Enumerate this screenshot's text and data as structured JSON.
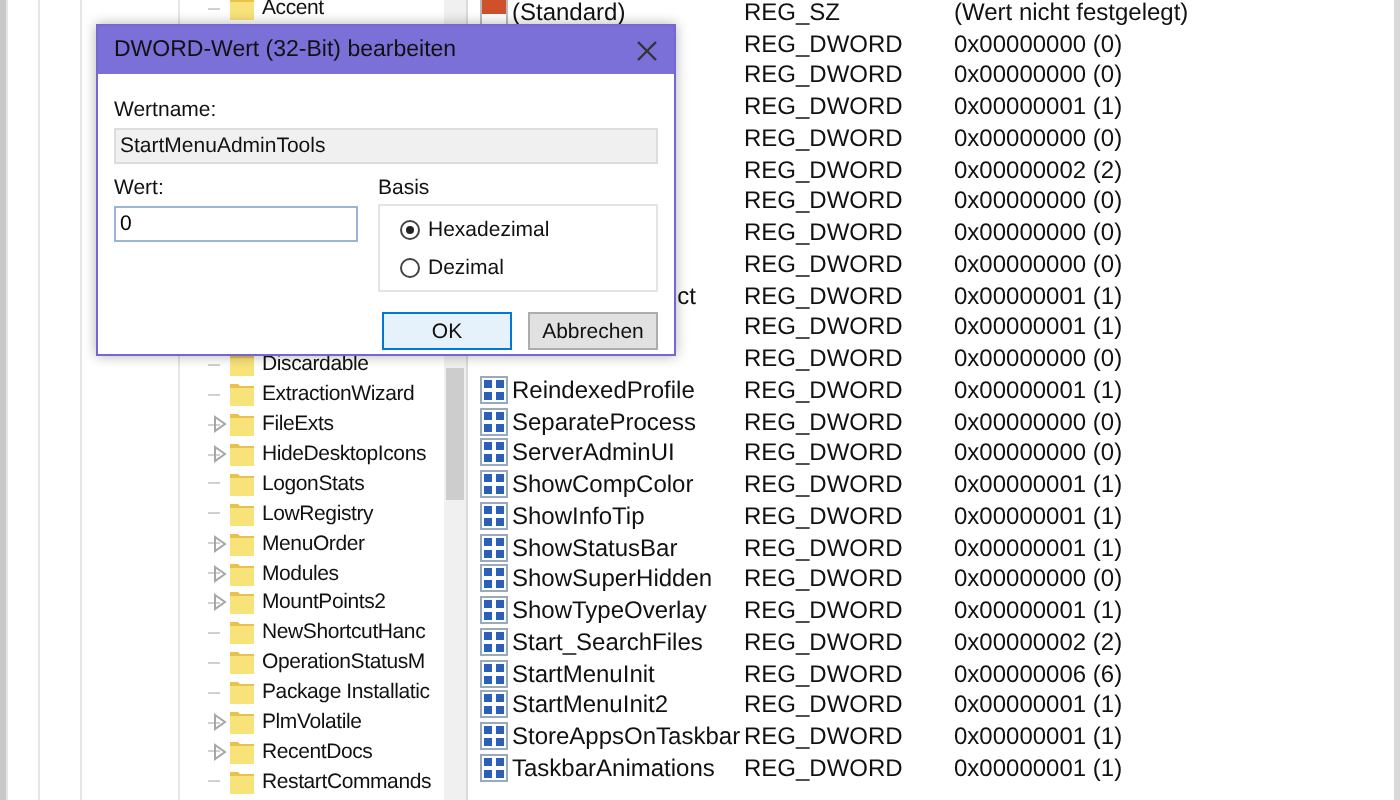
{
  "tree": {
    "items_above": [
      {
        "name": "Accent",
        "expandable": false
      }
    ],
    "items": [
      {
        "name": "Discardable",
        "expandable": false
      },
      {
        "name": "ExtractionWizard",
        "expandable": false
      },
      {
        "name": "FileExts",
        "expandable": true
      },
      {
        "name": "HideDesktopIcons",
        "expandable": true
      },
      {
        "name": "LogonStats",
        "expandable": false
      },
      {
        "name": "LowRegistry",
        "expandable": false
      },
      {
        "name": "MenuOrder",
        "expandable": true
      },
      {
        "name": "Modules",
        "expandable": true
      },
      {
        "name": "MountPoints2",
        "expandable": true
      },
      {
        "name": "NewShortcutHanc",
        "expandable": false
      },
      {
        "name": "OperationStatusM",
        "expandable": false
      },
      {
        "name": "Package Installatic",
        "expandable": false
      },
      {
        "name": "PlmVolatile",
        "expandable": true
      },
      {
        "name": "RecentDocs",
        "expandable": true
      },
      {
        "name": "RestartCommands",
        "expandable": false
      }
    ]
  },
  "values": {
    "rows": [
      {
        "kind": "string",
        "name": "(Standard)",
        "type": "REG_SZ",
        "data": "(Wert nicht festgelegt)"
      },
      {
        "type": "REG_DWORD",
        "data": "0x00000000 (0)"
      },
      {
        "type": "REG_DWORD",
        "data": "0x00000000 (0)"
      },
      {
        "type": "REG_DWORD",
        "data": "0x00000001 (1)"
      },
      {
        "type": "REG_DWORD",
        "data": "0x00000000 (0)"
      },
      {
        "type": "REG_DWORD",
        "data": "0x00000002 (2)"
      },
      {
        "type": "REG_DWORD",
        "data": "0x00000000 (0)"
      },
      {
        "type": "REG_DWORD",
        "data": "0x00000000 (0)"
      },
      {
        "type": "REG_DWORD",
        "data": "0x00000000 (0)"
      },
      {
        "name": "ct",
        "name_tail": true,
        "type": "REG_DWORD",
        "data": "0x00000001 (1)"
      },
      {
        "type": "REG_DWORD",
        "data": "0x00000001 (1)"
      },
      {
        "type": "REG_DWORD",
        "data": "0x00000000 (0)"
      },
      {
        "kind": "dword",
        "name": "ReindexedProfile",
        "type": "REG_DWORD",
        "data": "0x00000001 (1)"
      },
      {
        "kind": "dword",
        "name": "SeparateProcess",
        "type": "REG_DWORD",
        "data": "0x00000000 (0)"
      },
      {
        "kind": "dword",
        "name": "ServerAdminUI",
        "type": "REG_DWORD",
        "data": "0x00000000 (0)"
      },
      {
        "kind": "dword",
        "name": "ShowCompColor",
        "type": "REG_DWORD",
        "data": "0x00000001 (1)"
      },
      {
        "kind": "dword",
        "name": "ShowInfoTip",
        "type": "REG_DWORD",
        "data": "0x00000001 (1)"
      },
      {
        "kind": "dword",
        "name": "ShowStatusBar",
        "type": "REG_DWORD",
        "data": "0x00000001 (1)"
      },
      {
        "kind": "dword",
        "name": "ShowSuperHidden",
        "type": "REG_DWORD",
        "data": "0x00000000 (0)"
      },
      {
        "kind": "dword",
        "name": "ShowTypeOverlay",
        "type": "REG_DWORD",
        "data": "0x00000001 (1)"
      },
      {
        "kind": "dword",
        "name": "Start_SearchFiles",
        "type": "REG_DWORD",
        "data": "0x00000002 (2)"
      },
      {
        "kind": "dword",
        "name": "StartMenuInit",
        "type": "REG_DWORD",
        "data": "0x00000006 (6)"
      },
      {
        "kind": "dword",
        "name": "StartMenuInit2",
        "type": "REG_DWORD",
        "data": "0x00000001 (1)"
      },
      {
        "kind": "dword",
        "name": "StoreAppsOnTaskbar",
        "type": "REG_DWORD",
        "data": "0x00000001 (1)"
      },
      {
        "kind": "dword",
        "name": "TaskbarAnimations",
        "type": "REG_DWORD",
        "data": "0x00000001 (1)"
      }
    ]
  },
  "dialog": {
    "title": "DWORD-Wert (32-Bit) bearbeiten",
    "name_label": "Wertname:",
    "name_value": "StartMenuAdminTools",
    "value_label": "Wert:",
    "value": "0",
    "base_label": "Basis",
    "bases": [
      {
        "label": "Hexadezimal",
        "selected": true
      },
      {
        "label": "Dezimal",
        "selected": false
      }
    ],
    "buttons": [
      {
        "label": "OK",
        "focused": true
      },
      {
        "label": "Abbrechen",
        "focused": false
      }
    ]
  }
}
